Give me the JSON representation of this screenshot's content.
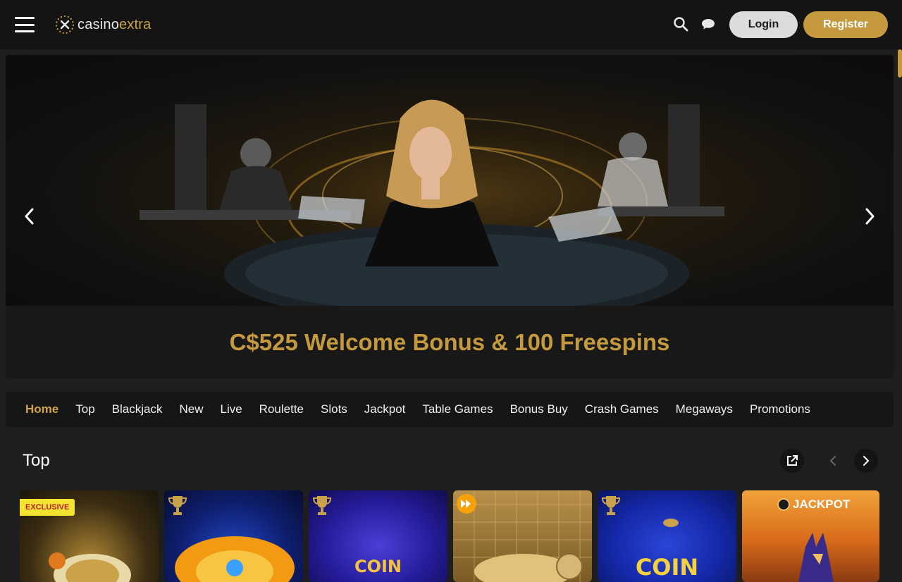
{
  "header": {
    "logo_part1": "casino",
    "logo_part2": "extra",
    "login_label": "Login",
    "register_label": "Register"
  },
  "hero": {
    "caption": "C$525 Welcome Bonus & 100 Freespins"
  },
  "categories": [
    "Home",
    "Top",
    "Blackjack",
    "New",
    "Live",
    "Roulette",
    "Slots",
    "Jackpot",
    "Table Games",
    "Bonus Buy",
    "Crash Games",
    "Megaways",
    "Promotions"
  ],
  "active_category": "Home",
  "section": {
    "title": "Top"
  },
  "tiles": [
    {
      "badge": "EXCLUSIVE"
    },
    {},
    {
      "label": "COIN"
    },
    {},
    {
      "label": "COIN"
    },
    {
      "label": "JACKPOT"
    }
  ],
  "colors": {
    "accent": "#c59a3e",
    "header_bg": "#141414",
    "page_bg": "#1e1e1e"
  }
}
